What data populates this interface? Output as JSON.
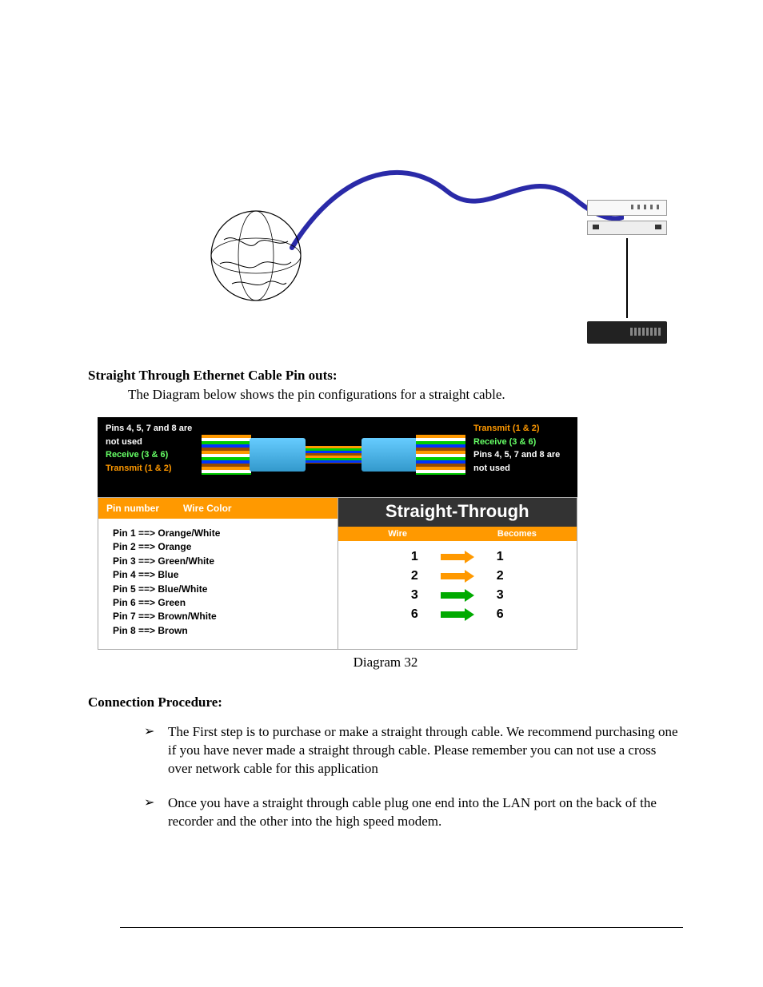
{
  "section1": {
    "heading": "Straight Through Ethernet Cable Pin outs:",
    "intro": "The Diagram below shows the pin configurations for a straight cable."
  },
  "cable_visual": {
    "left": {
      "unused": "Pins 4, 5, 7 and 8 are not used",
      "receive": "Receive (3 & 6)",
      "transmit": "Transmit (1 & 2)"
    },
    "right": {
      "transmit": "Transmit (1 & 2)",
      "receive": "Receive (3 & 6)",
      "unused": "Pins 4, 5, 7 and 8 are not used"
    }
  },
  "pin_table": {
    "hdr_pin": "Pin number",
    "hdr_color": "Wire Color",
    "rows": [
      "Pin 1 ==> Orange/White",
      "Pin 2 ==> Orange",
      "Pin 3 ==> Green/White",
      "Pin 4 ==> Blue",
      "Pin 5 ==> Blue/White",
      "Pin 6 ==> Green",
      "Pin 7 ==> Brown/White",
      "Pin 8 ==> Brown"
    ]
  },
  "straight": {
    "title": "Straight-Through",
    "sub_wire": "Wire",
    "sub_becomes": "Becomes",
    "map": [
      {
        "from": "1",
        "to": "1",
        "color": "orange"
      },
      {
        "from": "2",
        "to": "2",
        "color": "orange"
      },
      {
        "from": "3",
        "to": "3",
        "color": "green"
      },
      {
        "from": "6",
        "to": "6",
        "color": "green"
      }
    ]
  },
  "caption": "Diagram 32",
  "section2": {
    "heading": "Connection Procedure:",
    "bullets": [
      "The First step is to purchase or make a straight through cable. We recommend purchasing one if you have never made a straight through cable. Please remember you can not use a cross over network cable for this application",
      "Once you have a straight through cable plug one end into the LAN port on the back of the recorder and the other into the high speed modem."
    ]
  }
}
